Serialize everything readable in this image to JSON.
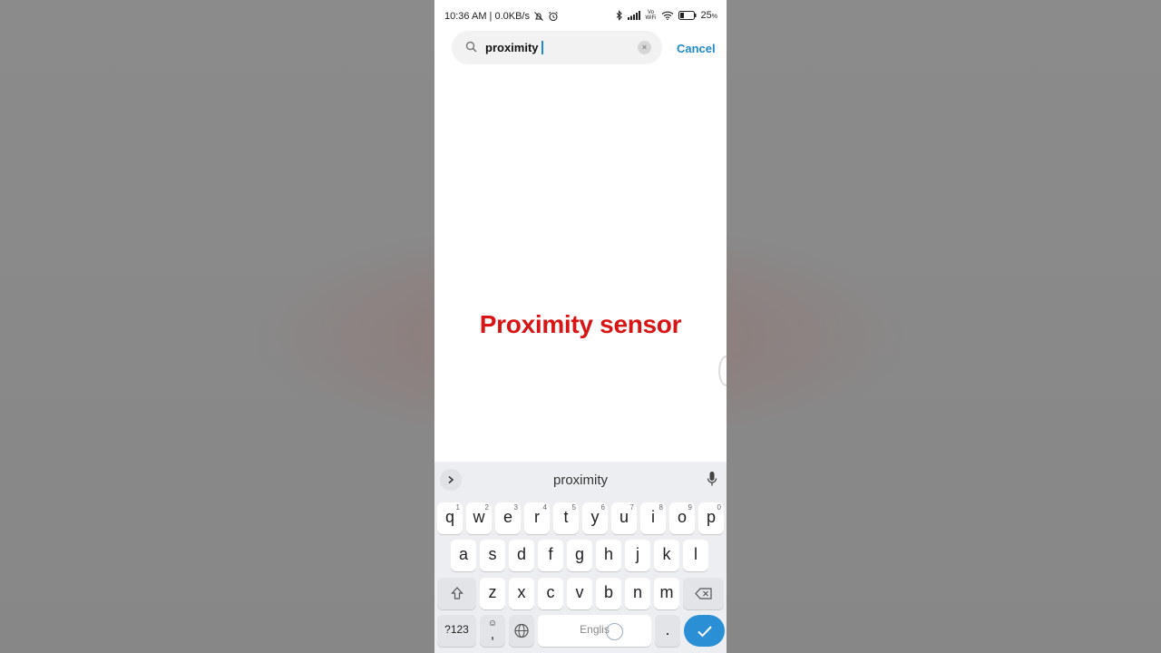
{
  "status_bar": {
    "time_and_speed": "10:36 AM | 0.0KB/s",
    "vowifi_top": "Vo",
    "vowifi_bottom": "WiFi",
    "battery_percent": "25",
    "battery_unit": "%"
  },
  "search": {
    "query": "proximity",
    "clear_label": "×",
    "cancel_label": "Cancel"
  },
  "caption": "Proximity sensor",
  "keyboard": {
    "suggestion": "proximity",
    "row1": [
      {
        "label": "q",
        "hint": "1"
      },
      {
        "label": "w",
        "hint": "2"
      },
      {
        "label": "e",
        "hint": "3"
      },
      {
        "label": "r",
        "hint": "4"
      },
      {
        "label": "t",
        "hint": "5"
      },
      {
        "label": "y",
        "hint": "6"
      },
      {
        "label": "u",
        "hint": "7"
      },
      {
        "label": "i",
        "hint": "8"
      },
      {
        "label": "o",
        "hint": "9"
      },
      {
        "label": "p",
        "hint": "0"
      }
    ],
    "row2": [
      "a",
      "s",
      "d",
      "f",
      "g",
      "h",
      "j",
      "k",
      "l"
    ],
    "row3": [
      "z",
      "x",
      "c",
      "v",
      "b",
      "n",
      "m"
    ],
    "symbols_label": "?123",
    "emoji_top": "☺",
    "comma_label": ",",
    "space_label": "Englis",
    "period_label": "."
  },
  "colors": {
    "accent": "#1e88c8",
    "caption": "#d81414",
    "enter_key": "#2b8fd6"
  }
}
